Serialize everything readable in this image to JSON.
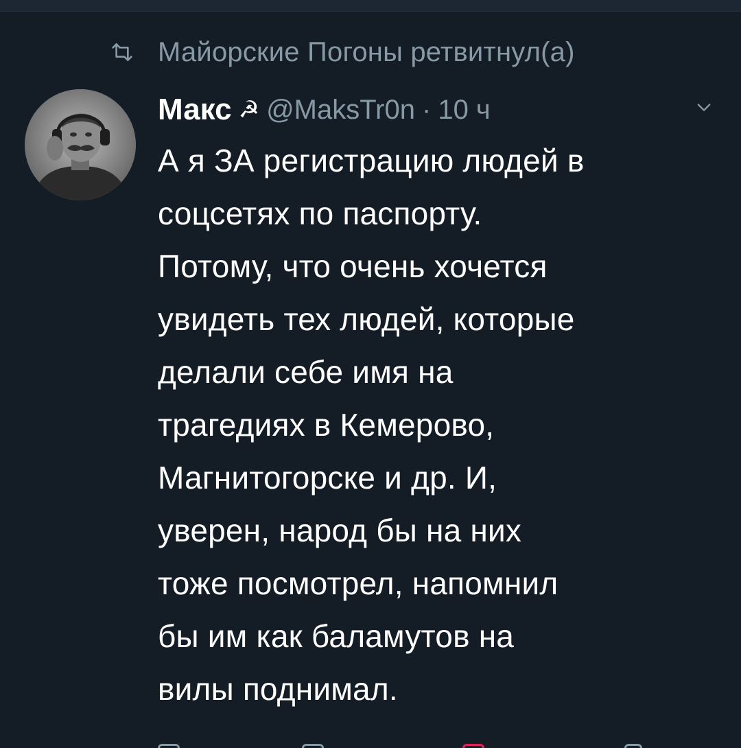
{
  "retweet_banner": {
    "text": "Майорские Погоны ретвитнул(а)",
    "icon": "retweet-icon"
  },
  "tweet": {
    "author": {
      "display_name": "Макс",
      "badge": "☭",
      "handle": "@MaksTr0n",
      "avatar_icon": "avatar-image"
    },
    "separator": "·",
    "time": "10 ч",
    "menu_icon": "chevron-down-icon",
    "lines": [
      "А я ЗА регистрацию людей в",
      "соцсетях по паспорту.",
      "Потому, что очень хочется",
      "увидеть тех людей, которые",
      "делали себе имя на",
      "трагедиях в Кемерово,",
      "Магнитогорске и др. И,",
      "уверен, народ бы на них",
      "тоже посмотрел, напомнил",
      "бы им как баламутов на",
      "вилы поднимал."
    ]
  },
  "actions": {
    "icons": [
      "reply-icon",
      "retweet-icon",
      "like-icon",
      "share-icon"
    ],
    "colors": {
      "muted": "#8899a6",
      "like": "#e0245e"
    }
  },
  "theme": {
    "background": "#141d26",
    "text": "#ffffff",
    "muted": "#8899a6"
  }
}
